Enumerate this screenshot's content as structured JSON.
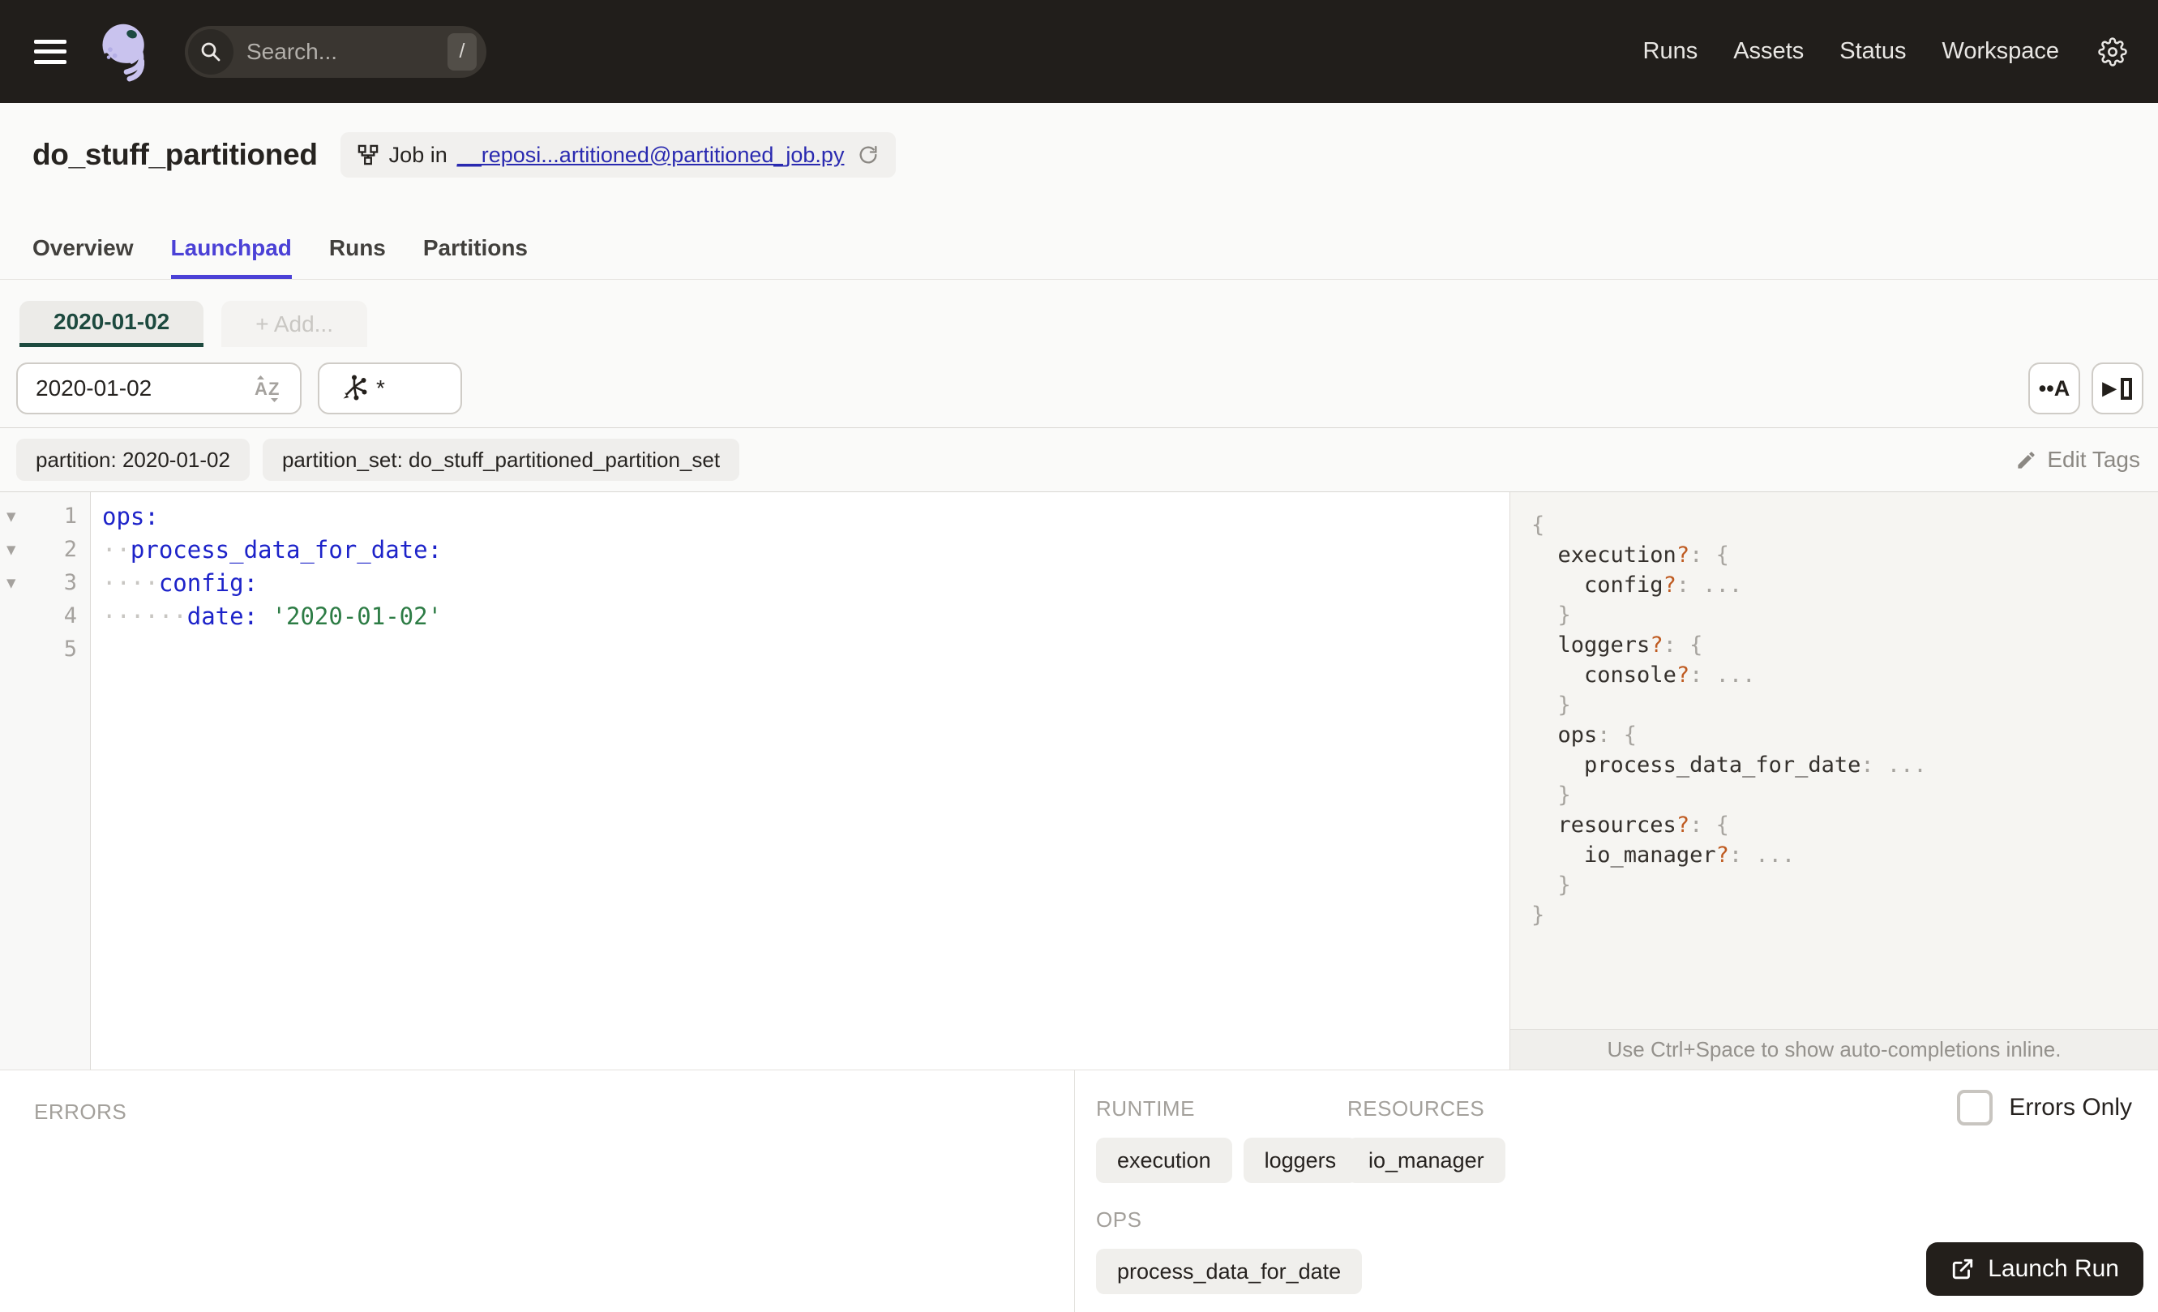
{
  "topbar": {
    "search": {
      "placeholder": "Search...",
      "shortcut": "/"
    },
    "nav": [
      {
        "label": "Runs"
      },
      {
        "label": "Assets"
      },
      {
        "label": "Status"
      },
      {
        "label": "Workspace"
      }
    ]
  },
  "header": {
    "title": "do_stuff_partitioned",
    "badge": {
      "prefix": "Job in",
      "link": "__reposi...artitioned@partitioned_job.py"
    },
    "tabs": [
      {
        "label": "Overview",
        "active": false
      },
      {
        "label": "Launchpad",
        "active": true
      },
      {
        "label": "Runs",
        "active": false
      },
      {
        "label": "Partitions",
        "active": false
      }
    ]
  },
  "launchpad": {
    "partition_tabs": [
      {
        "label": "2020-01-02",
        "active": true,
        "add": false
      },
      {
        "label": "+ Add...",
        "active": false,
        "add": true
      }
    ],
    "partition_input": "2020-01-02",
    "op_selector": "*",
    "tags": [
      "partition: 2020-01-02",
      "partition_set: do_stuff_partitioned_partition_set"
    ],
    "edit_tags_label": "Edit Tags"
  },
  "editor": {
    "lines": [
      {
        "num": "1",
        "fold": true,
        "tokens": [
          [
            "key",
            "ops:"
          ]
        ]
      },
      {
        "num": "2",
        "fold": true,
        "tokens": [
          [
            "ws",
            "··"
          ],
          [
            "key",
            "process_data_for_date:"
          ]
        ]
      },
      {
        "num": "3",
        "fold": true,
        "tokens": [
          [
            "ws",
            "····"
          ],
          [
            "key",
            "config:"
          ]
        ]
      },
      {
        "num": "4",
        "fold": false,
        "tokens": [
          [
            "ws",
            "······"
          ],
          [
            "key",
            "date:"
          ],
          [
            "plain",
            " "
          ],
          [
            "str",
            "'2020-01-02'"
          ]
        ]
      },
      {
        "num": "5",
        "fold": false,
        "tokens": []
      }
    ]
  },
  "schema": {
    "lines": [
      [
        [
          "p",
          "{"
        ]
      ],
      [
        [
          "p",
          "  "
        ],
        [
          "k",
          "execution"
        ],
        [
          "q",
          "?"
        ],
        [
          "p",
          ": {"
        ]
      ],
      [
        [
          "p",
          "    "
        ],
        [
          "k",
          "config"
        ],
        [
          "q",
          "?"
        ],
        [
          "p",
          ": ..."
        ]
      ],
      [
        [
          "p",
          "  }"
        ]
      ],
      [
        [
          "p",
          "  "
        ],
        [
          "k",
          "loggers"
        ],
        [
          "q",
          "?"
        ],
        [
          "p",
          ": {"
        ]
      ],
      [
        [
          "p",
          "    "
        ],
        [
          "k",
          "console"
        ],
        [
          "q",
          "?"
        ],
        [
          "p",
          ": ..."
        ]
      ],
      [
        [
          "p",
          "  }"
        ]
      ],
      [
        [
          "p",
          "  "
        ],
        [
          "k",
          "ops"
        ],
        [
          "p",
          ": {"
        ]
      ],
      [
        [
          "p",
          "    "
        ],
        [
          "k",
          "process_data_for_date"
        ],
        [
          "p",
          ": ..."
        ]
      ],
      [
        [
          "p",
          "  }"
        ]
      ],
      [
        [
          "p",
          "  "
        ],
        [
          "k",
          "resources"
        ],
        [
          "q",
          "?"
        ],
        [
          "p",
          ": {"
        ]
      ],
      [
        [
          "p",
          "    "
        ],
        [
          "k",
          "io_manager"
        ],
        [
          "q",
          "?"
        ],
        [
          "p",
          ": ..."
        ]
      ],
      [
        [
          "p",
          "  }"
        ]
      ],
      [
        [
          "p",
          "}"
        ]
      ]
    ],
    "hint": "Use Ctrl+Space to show auto-completions inline."
  },
  "bottom": {
    "errors_label": "ERRORS",
    "groups": [
      {
        "label": "RUNTIME",
        "chips": [
          "execution",
          "loggers"
        ]
      },
      {
        "label": "RESOURCES",
        "chips": [
          "io_manager"
        ]
      },
      {
        "label": "OPS",
        "chips": [
          "process_data_for_date"
        ]
      }
    ],
    "errors_only_label": "Errors Only",
    "launch_label": "Launch Run"
  },
  "colors": {
    "accent": "#4b41d6",
    "partition_green": "#1d4a3f",
    "topbar": "#211e1b",
    "code_key": "#1d23c9",
    "code_string": "#2d7c45",
    "schema_optional": "#bf5b21",
    "link": "#2a2ab0"
  }
}
